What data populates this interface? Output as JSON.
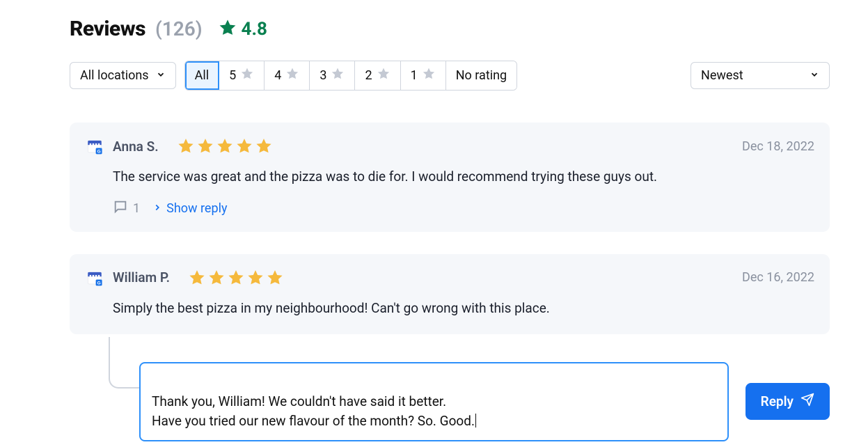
{
  "header": {
    "title": "Reviews",
    "count": "(126)",
    "rating": "4.8"
  },
  "filters": {
    "location": "All locations",
    "segments": {
      "all": "All",
      "s5": "5",
      "s4": "4",
      "s3": "3",
      "s2": "2",
      "s1": "1",
      "none": "No rating"
    },
    "sort": "Newest"
  },
  "reviews": [
    {
      "name": "Anna S.",
      "date": "Dec 18, 2022",
      "text": "The service was great and the pizza was to die for. I would recommend trying these guys out.",
      "reply_count": "1",
      "show_reply": "Show reply"
    },
    {
      "name": "William P.",
      "date": "Dec 16, 2022",
      "text": "Simply the best pizza in my neighbourhood! Can't go wrong with this place."
    }
  ],
  "compose": {
    "text": "Thank you, William! We couldn't have said it better.\nHave you tried our new flavour of the month? So. Good.",
    "btn": "Reply"
  }
}
